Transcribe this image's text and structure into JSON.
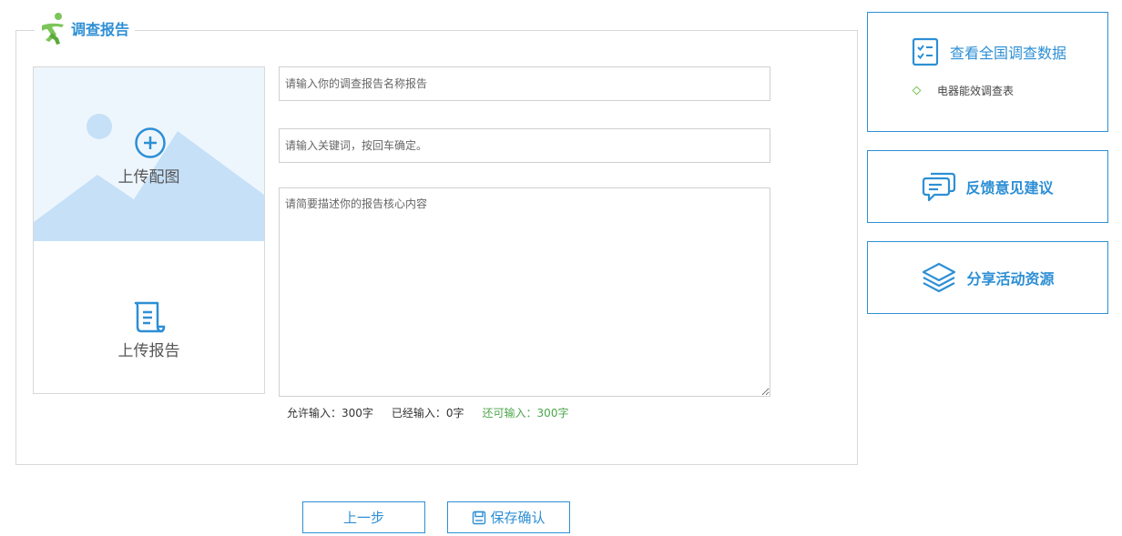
{
  "section": {
    "title": "调查报告"
  },
  "upload": {
    "image_label": "上传配图",
    "report_label": "上传报告"
  },
  "form": {
    "name_placeholder": "请输入你的调查报告名称报告",
    "keywords_placeholder": "请输入关键词，按回车确定。",
    "content_placeholder": "请简要描述你的报告核心内容",
    "counter": {
      "allowed": "允许输入：300字",
      "entered": "已经输入：0字",
      "remaining": "还可输入：300字"
    }
  },
  "buttons": {
    "prev": "上一步",
    "save": "保存确认"
  },
  "sidebar": {
    "survey_title": "查看全国调查数据",
    "survey_items": [
      "电器能效调查表"
    ],
    "feedback_title": "反馈意见建议",
    "share_title": "分享活动资源"
  },
  "colors": {
    "accent": "#2d8fd5",
    "remaining": "#4aa64a",
    "upload_bg": "#eef6fd",
    "mountain": "#c6e0f8",
    "logo_green": "#7cc55a"
  },
  "icons": {
    "section_logo": "running-figure-icon",
    "upload_image": "plus-circle-icon",
    "upload_report": "scroll-document-icon",
    "save": "save-floppy-icon",
    "survey": "checklist-icon",
    "feedback": "chat-bubble-icon",
    "share": "layers-icon"
  }
}
